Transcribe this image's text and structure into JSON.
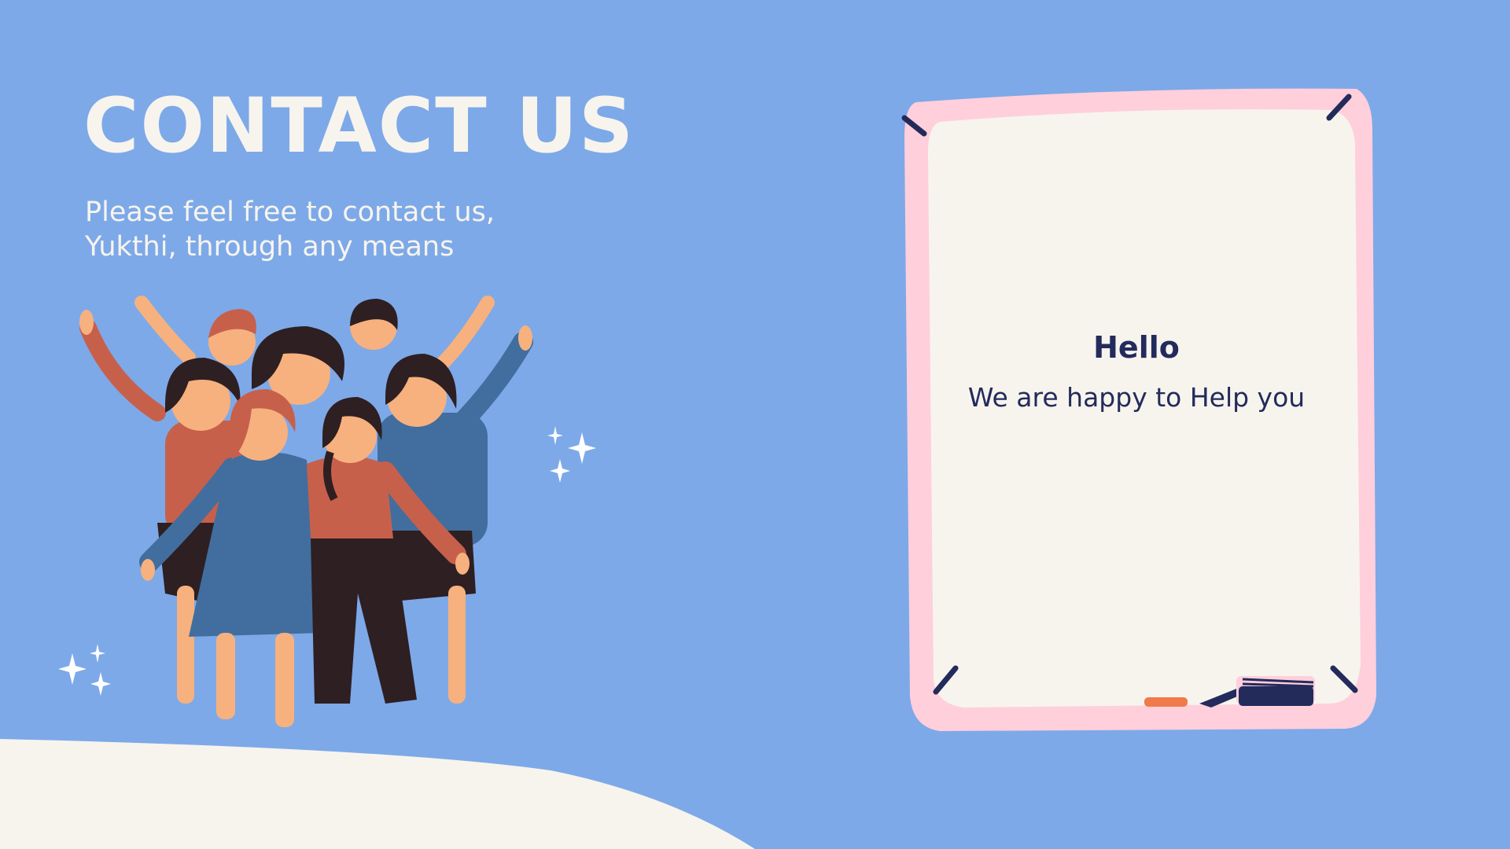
{
  "header": {
    "title": "CONTACT US",
    "subtitle": "Please feel free to contact us,\nYukthi, through any means"
  },
  "card": {
    "greeting": "Hello",
    "message": "We are happy to Help you"
  },
  "colors": {
    "background": "#7da9e8",
    "cream": "#f7f4ee",
    "frame_pink": "#ffcfdc",
    "navy": "#232b5b",
    "skin": "#f7b17e",
    "rust": "#c7604b",
    "blue_shirt": "#416e9e",
    "dark": "#2e1f22"
  },
  "icons": [
    "sparkle-icon",
    "group-of-women-illustration",
    "whiteboard-frame"
  ]
}
